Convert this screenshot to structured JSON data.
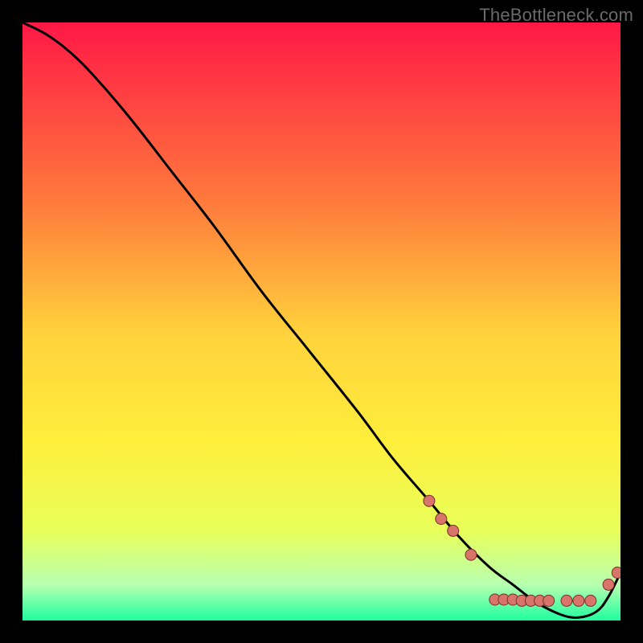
{
  "watermark": "TheBottleneck.com",
  "colors": {
    "frame": "#000000",
    "watermark_text": "#6a6a6a",
    "gradient_top": "#ff1846",
    "gradient_mid_upper": "#ff7a3c",
    "gradient_mid": "#ffd23c",
    "gradient_mid_lower": "#ffee3c",
    "gradient_lower": "#e8ff5a",
    "gradient_green_pale": "#b8ffb0",
    "gradient_green": "#1fffa0",
    "curve": "#000000",
    "marker_fill": "#d9746b",
    "marker_stroke": "#7a2f29"
  },
  "chart_data": {
    "type": "line",
    "title": "",
    "xlabel": "",
    "ylabel": "",
    "xlim": [
      0,
      100
    ],
    "ylim": [
      0,
      100
    ],
    "grid": false,
    "legend": false,
    "series": [
      {
        "name": "bottleneck-curve",
        "x": [
          0,
          4,
          8,
          12,
          18,
          25,
          32,
          40,
          48,
          56,
          62,
          68,
          73,
          78,
          82,
          86,
          90,
          93,
          96,
          98,
          100
        ],
        "y": [
          100,
          98,
          95,
          91,
          84,
          75,
          66,
          55,
          45,
          35,
          27,
          20,
          14,
          9,
          6,
          3,
          1,
          0.5,
          1.5,
          4,
          8
        ]
      }
    ],
    "markers": [
      {
        "x": 68,
        "y": 20
      },
      {
        "x": 70,
        "y": 17
      },
      {
        "x": 72,
        "y": 15
      },
      {
        "x": 75,
        "y": 11
      },
      {
        "x": 79,
        "y": 3.5
      },
      {
        "x": 80.5,
        "y": 3.5
      },
      {
        "x": 82,
        "y": 3.5
      },
      {
        "x": 83.5,
        "y": 3.3
      },
      {
        "x": 85,
        "y": 3.3
      },
      {
        "x": 86.5,
        "y": 3.3
      },
      {
        "x": 88,
        "y": 3.3
      },
      {
        "x": 91,
        "y": 3.3
      },
      {
        "x": 93,
        "y": 3.3
      },
      {
        "x": 95,
        "y": 3.3
      },
      {
        "x": 98,
        "y": 6
      },
      {
        "x": 99.5,
        "y": 8
      }
    ]
  }
}
